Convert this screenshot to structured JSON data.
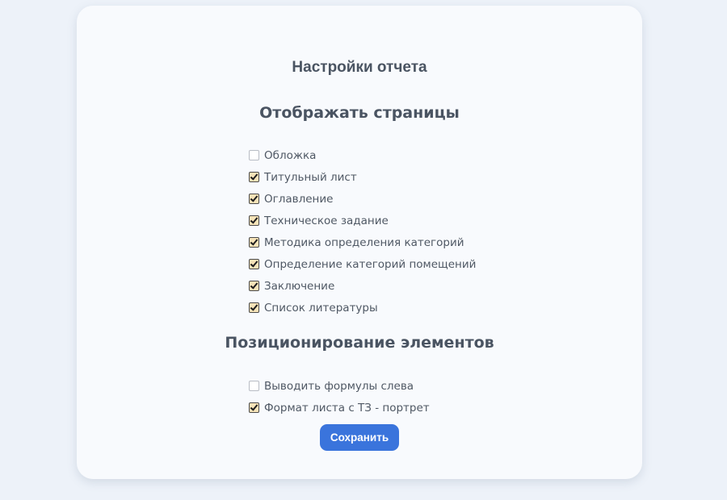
{
  "report": {
    "title": "Настройки отчета"
  },
  "sections": {
    "pages": {
      "title": "Отображать страницы",
      "items": [
        {
          "label": "Обложка",
          "checked": false
        },
        {
          "label": "Титульный лист",
          "checked": true
        },
        {
          "label": "Оглавление",
          "checked": true
        },
        {
          "label": "Техническое задание",
          "checked": true
        },
        {
          "label": "Методика определения категорий",
          "checked": true
        },
        {
          "label": "Определение категорий помещений",
          "checked": true
        },
        {
          "label": "Заключение",
          "checked": true
        },
        {
          "label": "Список литературы",
          "checked": true
        }
      ]
    },
    "positioning": {
      "title": "Позиционирование элементов",
      "items": [
        {
          "label": "Выводить формулы слева",
          "checked": false
        },
        {
          "label": "Формат листа с ТЗ - портрет",
          "checked": true
        }
      ]
    }
  },
  "actions": {
    "save_label": "Сохранить"
  },
  "colors": {
    "accent": "#3a74dc",
    "page_background": "#edf2f9",
    "card_background": "#f8fafd",
    "checkbox_checked_fill": "#f6e3b8"
  }
}
